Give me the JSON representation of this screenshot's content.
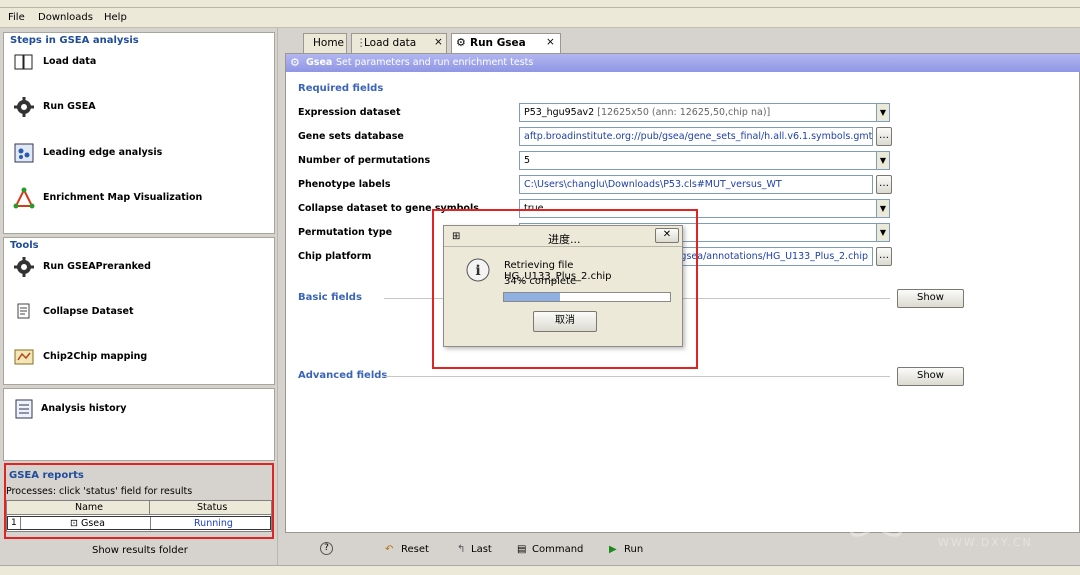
{
  "menu": [
    "File",
    "Downloads",
    "Help"
  ],
  "steps": {
    "title": "Steps in GSEA analysis",
    "items": [
      "Load data",
      "Run GSEA",
      "Leading edge analysis",
      "Enrichment Map Visualization"
    ]
  },
  "tools": {
    "title": "Tools",
    "items": [
      "Run GSEAPreranked",
      "Collapse Dataset",
      "Chip2Chip mapping"
    ]
  },
  "history": {
    "label": "Analysis history"
  },
  "reports": {
    "title": "GSEA reports",
    "subtitle": "Processes: click 'status' field for results",
    "columns": [
      "Name",
      "Status"
    ],
    "rows": [
      {
        "index": "1",
        "name": "Gsea",
        "status": "Running"
      }
    ],
    "show_folder": "Show results folder"
  },
  "tabs": [
    {
      "label": "Home",
      "closable": false
    },
    {
      "label": "Load data",
      "closable": true
    },
    {
      "label": "Run Gsea",
      "closable": true
    }
  ],
  "gsea_header": {
    "title": "Gsea",
    "subtitle": "Set parameters and run enrichment tests"
  },
  "required": {
    "title": "Required fields",
    "fields": [
      {
        "label": "Expression dataset",
        "value": "P53_hgu95av2",
        "value_note": "[12625x50 (ann: 12625,50,chip na)]"
      },
      {
        "label": "Gene sets database",
        "value": "aftp.broadinstitute.org://pub/gsea/gene_sets_final/h.all.v6.1.symbols.gmt"
      },
      {
        "label": "Number of permutations",
        "value": "5"
      },
      {
        "label": "Phenotype labels",
        "value": "C:\\Users\\changlu\\Downloads\\P53.cls#MUT_versus_WT"
      },
      {
        "label": "Collapse dataset to gene symbols",
        "value": "true"
      },
      {
        "label": "Permutation type",
        "value": ""
      },
      {
        "label": "Chip platform",
        "value": "gsea/annotations/HG_U133_Plus_2.chip"
      }
    ]
  },
  "basic": {
    "title": "Basic fields",
    "button": "Show"
  },
  "advanced": {
    "title": "Advanced fields",
    "button": "Show"
  },
  "dialog": {
    "title": "进度...",
    "message": "Retrieving file HG_U133_Plus_2.chip",
    "percent_text": "34% complete",
    "progress": 0.34,
    "cancel": "取消"
  },
  "bottom": {
    "help": "?",
    "reset": "Reset",
    "last": "Last",
    "command": "Command",
    "run": "Run"
  },
  "watermark": {
    "brand": "丁香园",
    "url": "WWW.DXY.CN"
  },
  "colors": {
    "accent": "#1f4c9b",
    "highlight": "#e02424",
    "running": "#1a3fcc"
  }
}
